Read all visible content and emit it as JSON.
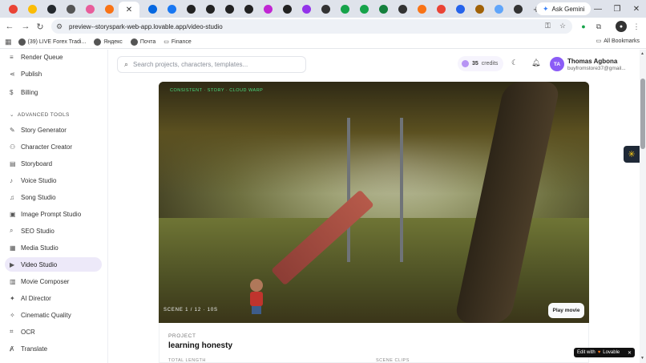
{
  "browser": {
    "tabs_favicons": [
      {
        "icon": "chrome-red-icon",
        "color": "#ea4335"
      },
      {
        "icon": "sun-icon",
        "color": "#fbbc05"
      },
      {
        "icon": "github-icon",
        "color": "#24292e"
      },
      {
        "icon": "target-icon",
        "color": "#555555"
      },
      {
        "icon": "folder-icon",
        "color": "#e85d9b"
      },
      {
        "icon": "lovable-icon",
        "color": "#f97316"
      }
    ],
    "tabs_favicons_right": [
      {
        "icon": "meta-icon",
        "color": "#0668e1"
      },
      {
        "icon": "facebook-icon",
        "color": "#1877f2"
      },
      {
        "icon": "circle-icon",
        "color": "#222222"
      },
      {
        "icon": "circle-icon",
        "color": "#222222"
      },
      {
        "icon": "circle-icon",
        "color": "#222222"
      },
      {
        "icon": "circle-icon",
        "color": "#222222"
      },
      {
        "icon": "purple-circle-icon",
        "color": "#c026d3"
      },
      {
        "icon": "circle-icon",
        "color": "#222222"
      },
      {
        "icon": "purple-circle-icon",
        "color": "#9333ea"
      },
      {
        "icon": "gear-icon",
        "color": "#333333"
      },
      {
        "icon": "arrow-icon",
        "color": "#16a34a"
      },
      {
        "icon": "green-icon",
        "color": "#16a34a"
      },
      {
        "icon": "green-icon",
        "color": "#15803d"
      },
      {
        "icon": "link-icon",
        "color": "#333333"
      },
      {
        "icon": "orange-icon",
        "color": "#f97316"
      },
      {
        "icon": "gmail-icon",
        "color": "#ea4335"
      },
      {
        "icon": "blue-icon",
        "color": "#2563eb"
      },
      {
        "icon": "play-icon",
        "color": "#a16207"
      },
      {
        "icon": "blue-icon",
        "color": "#60a5fa"
      },
      {
        "icon": "link-icon",
        "color": "#333333"
      }
    ],
    "active_tab_close": "✕",
    "new_tab": "+",
    "ask_gemini": "Ask Gemini",
    "url": "preview--storyspark-web-app.lovable.app/video-studio",
    "bookmarks": [
      {
        "label": "(39) LIVE Forex Tradi..."
      },
      {
        "label": "Яндекс"
      },
      {
        "label": "Почта"
      },
      {
        "label": "Finance"
      }
    ],
    "all_bookmarks": "All Bookmarks"
  },
  "sidebar": {
    "items_top": [
      {
        "label": "Render Queue",
        "icon": "queue-icon"
      },
      {
        "label": "Publish",
        "icon": "share-icon"
      },
      {
        "label": "Billing",
        "icon": "dollar-icon"
      }
    ],
    "section_title": "ADVANCED TOOLS",
    "items": [
      {
        "label": "Story Generator",
        "icon": "wand-icon"
      },
      {
        "label": "Character Creator",
        "icon": "users-icon"
      },
      {
        "label": "Storyboard",
        "icon": "storyboard-icon"
      },
      {
        "label": "Voice Studio",
        "icon": "microphone-icon"
      },
      {
        "label": "Song Studio",
        "icon": "music-icon"
      },
      {
        "label": "Image Prompt Studio",
        "icon": "image-icon"
      },
      {
        "label": "SEO Studio",
        "icon": "search-icon"
      },
      {
        "label": "Media Studio",
        "icon": "media-icon"
      },
      {
        "label": "Video Studio",
        "icon": "video-icon",
        "active": true
      },
      {
        "label": "Movie Composer",
        "icon": "film-icon"
      },
      {
        "label": "AI Director",
        "icon": "director-icon"
      },
      {
        "label": "Cinematic Quality",
        "icon": "sparkle-icon"
      },
      {
        "label": "OCR",
        "icon": "scan-icon"
      },
      {
        "label": "Translate",
        "icon": "translate-icon"
      }
    ]
  },
  "header": {
    "search_placeholder": "Search projects, characters, templates...",
    "credits_value": "35",
    "credits_label": "credits",
    "avatar_initials": "TA",
    "user_name": "Thomas Agbona",
    "user_email": "buyfromstore37@gmail..."
  },
  "video": {
    "overlay_text": "CONSISTENT · STORY · CLOUD WARP",
    "scene_info": "SCENE 1 / 12 · 10S",
    "play_label": "Play movie"
  },
  "project": {
    "label": "PROJECT",
    "title": "learning honesty",
    "total_length_label": "TOTAL LENGTH",
    "scene_clips_label": "SCENE CLIPS"
  },
  "lovable_badge": {
    "text": "Edit with",
    "brand": "Lovable",
    "close": "✕"
  },
  "colors": {
    "accent": "#8b5cf6",
    "active_bg": "#ede9f9",
    "overlay_green": "#4ade80"
  }
}
